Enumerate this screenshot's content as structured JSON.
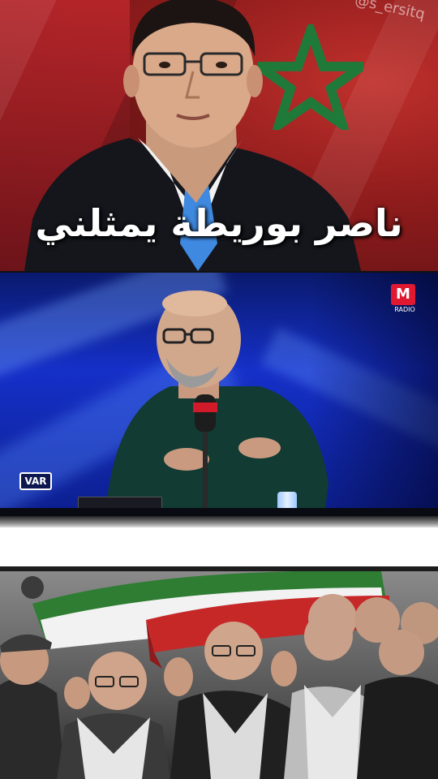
{
  "panel_top": {
    "caption": "ناصر بوريطة يمثلني",
    "watermark": "@s_ersitq",
    "flag_colors": {
      "red": "#c0302c",
      "star_green": "#1f7a3a"
    }
  },
  "panel_middle": {
    "channel_logo_text": "M",
    "channel_logo_sub": "RADIO",
    "var_badge": "VAR",
    "var_badge_sub": "",
    "background_color": "#1530c8"
  },
  "panel_bottom": {
    "flag_colors": {
      "red": "#c62828",
      "green": "#2e7d32",
      "white": "#f2f2f2"
    }
  }
}
